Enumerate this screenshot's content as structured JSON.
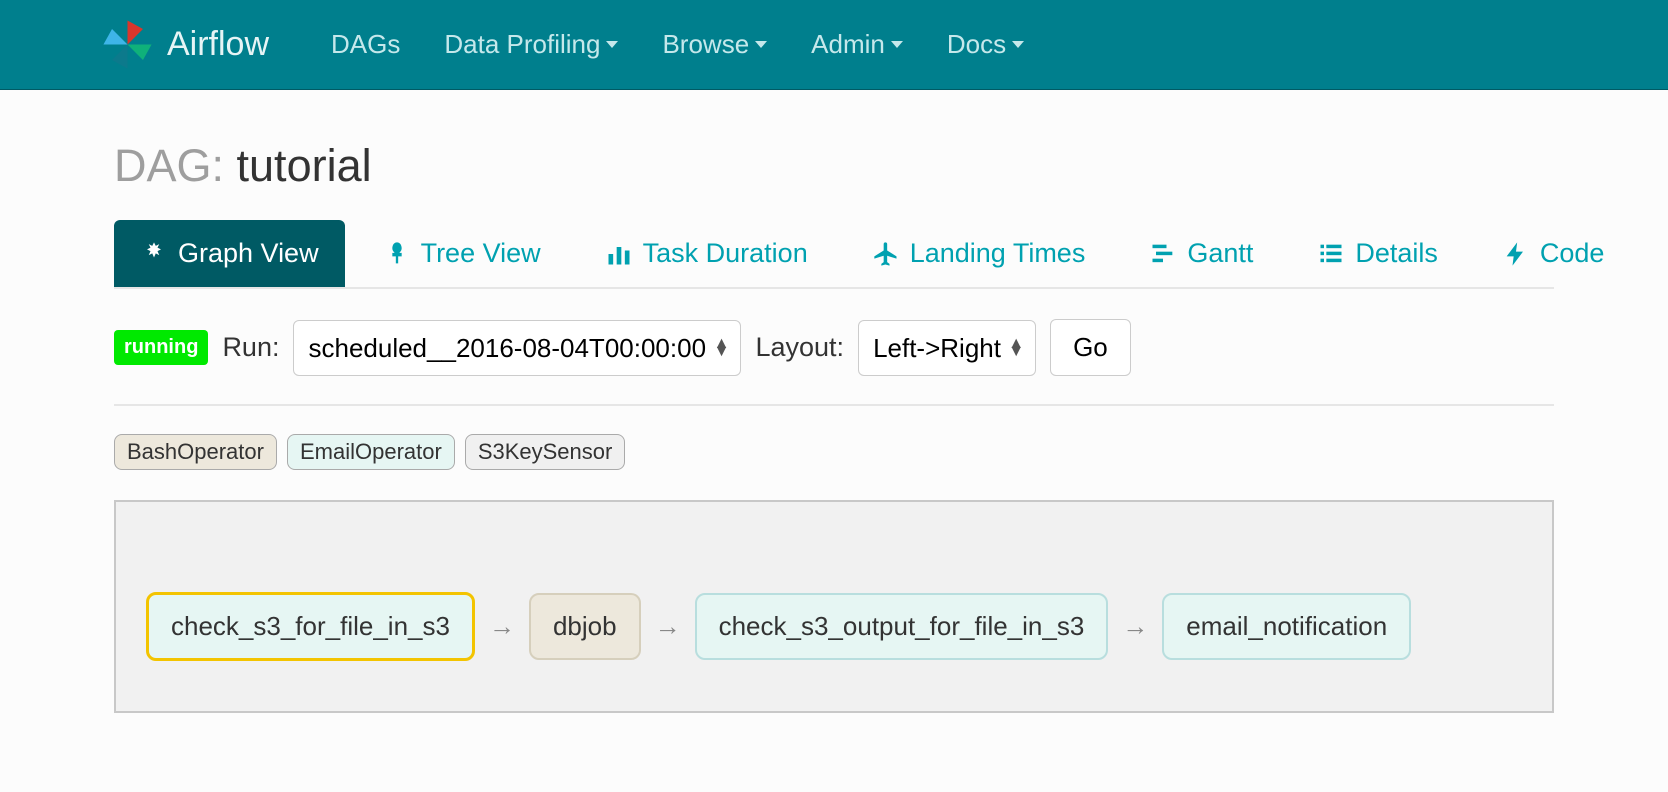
{
  "brand": "Airflow",
  "nav": {
    "dags": "DAGs",
    "data_profiling": "Data Profiling",
    "browse": "Browse",
    "admin": "Admin",
    "docs": "Docs"
  },
  "title_prefix": "DAG: ",
  "title_name": "tutorial",
  "tabs": {
    "graph": "Graph View",
    "tree": "Tree View",
    "task_duration": "Task Duration",
    "landing": "Landing Times",
    "gantt": "Gantt",
    "details": "Details",
    "code": "Code"
  },
  "controls": {
    "status_badge": "running",
    "run_label": "Run:",
    "run_value": "scheduled__2016-08-04T00:00:00",
    "layout_label": "Layout:",
    "layout_value": "Left->Right",
    "go": "Go"
  },
  "legend": {
    "bash": "BashOperator",
    "email": "EmailOperator",
    "s3": "S3KeySensor"
  },
  "graph": {
    "nodes": [
      {
        "id": "check_s3_for_file_in_s3",
        "type": "s3",
        "highlighted": true
      },
      {
        "id": "dbjob",
        "type": "bash",
        "highlighted": false
      },
      {
        "id": "check_s3_output_for_file_in_s3",
        "type": "s3",
        "highlighted": false
      },
      {
        "id": "email_notification",
        "type": "email",
        "highlighted": false
      }
    ]
  }
}
